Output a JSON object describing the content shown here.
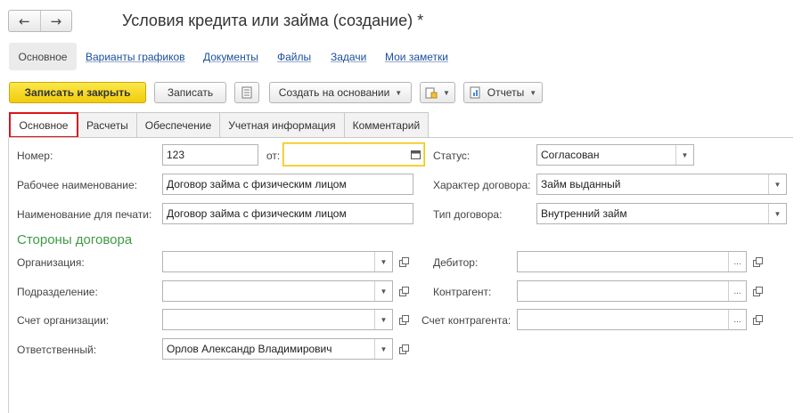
{
  "window": {
    "back_icon": "arrow-left-icon",
    "forward_icon": "arrow-right-icon",
    "title": "Условия кредита или займа (создание) *"
  },
  "sections": {
    "active": "Основное",
    "links": [
      "Варианты графиков",
      "Документы",
      "Файлы",
      "Задачи",
      "Мои заметки"
    ]
  },
  "toolbar": {
    "save_close": "Записать и закрыть",
    "save": "Записать",
    "create_based": "Создать на основании",
    "reports": "Отчеты"
  },
  "tabs": [
    "Основное",
    "Расчеты",
    "Обеспечение",
    "Учетная информация",
    "Комментарий"
  ],
  "active_tab": "Основное",
  "active_tab_highlight_color": "#d9161c",
  "form": {
    "number_label": "Номер:",
    "number_value": "123",
    "from_label": "от:",
    "date_value": "",
    "status_label": "Статус:",
    "status_value": "Согласован",
    "work_name_label": "Рабочее наименование:",
    "work_name_value": "Договор займа с физическим лицом",
    "print_name_label": "Наименование для печати:",
    "print_name_value": "Договор займа с физическим лицом",
    "character_label": "Характер договора:",
    "character_value": "Займ выданный",
    "type_label": "Тип договора:",
    "type_value": "Внутренний займ",
    "parties_title": "Стороны договора",
    "parties_title_color": "#3f9a45",
    "org_label": "Организация:",
    "org_value": "",
    "debtor_label": "Дебитор:",
    "debtor_value": "",
    "division_label": "Подразделение:",
    "division_value": "",
    "counterparty_label": "Контрагент:",
    "counterparty_value": "",
    "org_account_label": "Счет организации:",
    "org_account_value": "",
    "cp_account_label": "Счет контрагента:",
    "cp_account_value": "",
    "responsible_label": "Ответственный:",
    "responsible_value": "Орлов Александр Владимирович",
    "select_glyph": "..."
  },
  "primary_button_color": "#f5d521"
}
